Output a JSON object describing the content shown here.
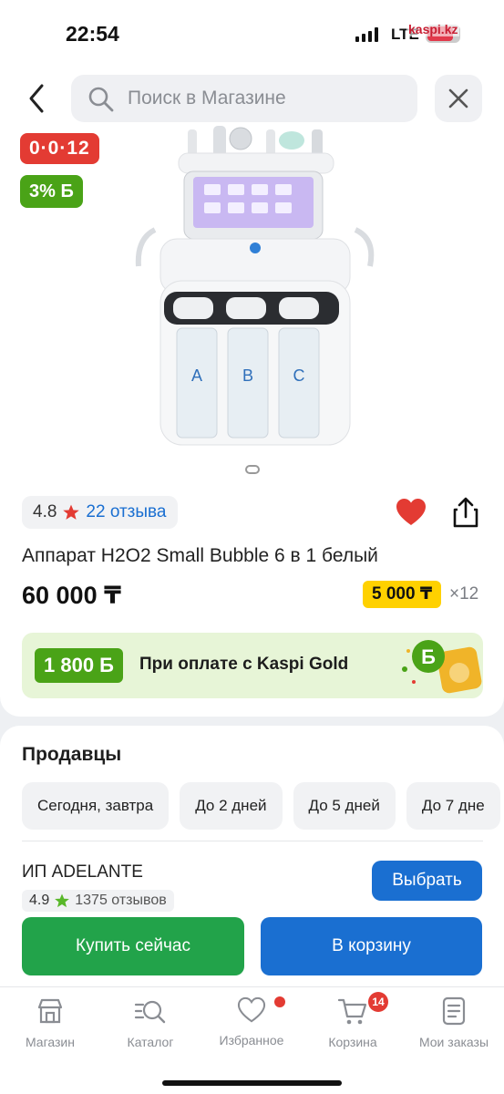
{
  "status_bar": {
    "time": "22:54",
    "network": "LTE",
    "watermark": "kaspi.kz",
    "battery_color": "#e2394b"
  },
  "header": {
    "back_icon": "chevron-left-icon",
    "search_placeholder": "Поиск в Магазине",
    "close_icon": "close-icon"
  },
  "product": {
    "timer_badge": "0·0·12",
    "bonus_badge": "3% Б",
    "image_dots": 1,
    "rating": "4.8",
    "reviews": "22 отзыва",
    "title": "Аппарат H2O2 Small Bubble 6 в 1 белый",
    "price": "60 000 ₸",
    "installment_amount": "5 000 ₸",
    "installment_months": "×12",
    "favorited": true,
    "promo_amount": "1 800 Б",
    "promo_text": "При оплате с Kaspi Gold",
    "promo_coin_label": "Б"
  },
  "sellers": {
    "title": "Продавцы",
    "chips": [
      "Сегодня, завтра",
      "До 2 дней",
      "До 5 дней",
      "До 7 дне"
    ],
    "seller_name": "ИП ADELANTE",
    "seller_rating": "4.9",
    "seller_reviews": "1375 отзывов",
    "select_label": "Выбрать"
  },
  "actions": {
    "buy_now": "Купить сейчас",
    "to_cart": "В корзину"
  },
  "tabs": [
    {
      "label": "Магазин",
      "icon": "store-icon"
    },
    {
      "label": "Каталог",
      "icon": "catalog-search-icon"
    },
    {
      "label": "Избранное",
      "icon": "heart-outline-icon",
      "dot": true
    },
    {
      "label": "Корзина",
      "icon": "cart-icon",
      "badge": "14"
    },
    {
      "label": "Мои заказы",
      "icon": "orders-icon"
    }
  ],
  "colors": {
    "brand_red": "#e33b33",
    "bonus_green": "#4aa317",
    "action_blue": "#1a6fd1",
    "buy_green": "#22a34a",
    "installment_yellow": "#ffd100"
  }
}
